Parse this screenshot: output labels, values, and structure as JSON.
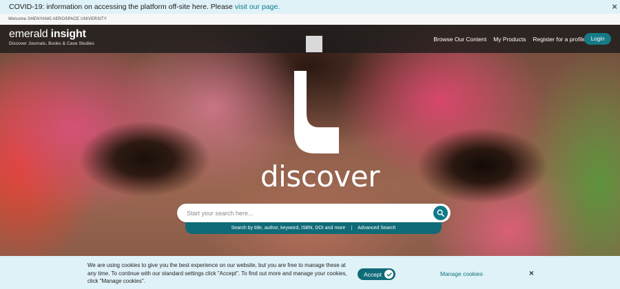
{
  "banner": {
    "text": "COVID-19: information on accessing the platform off-site here. Please",
    "link": "visit our page.",
    "close_icon": "×"
  },
  "welcome": {
    "text": "Welcome SHENYANG AEROSPACE UNIVERSITY"
  },
  "brand": {
    "word1": "emerald ",
    "word2": "insight",
    "tagline": "Discover Journals, Books & Case Studies"
  },
  "nav": {
    "items": [
      "Browse Our Content",
      "My Products",
      "Register for a profile"
    ],
    "login": "Login"
  },
  "hero": {
    "heading": "discover"
  },
  "search": {
    "placeholder": "Start your search here...",
    "hint": "Search by title, author, keyword, ISBN, DOI and more",
    "separator": "|",
    "advanced": "Advanced Search"
  },
  "cookies": {
    "message": "We are using cookies to give you the best experience on our website, but you are free to manage these at any time. To continue with our standard settings click \"Accept\". To find out more and manage your cookies, click \"Manage cookies\".",
    "accept": "Accept",
    "manage": "Manage cookies",
    "close_icon": "×"
  },
  "colors": {
    "teal": "#0f6b77",
    "banner_bg": "#dff2f7"
  }
}
